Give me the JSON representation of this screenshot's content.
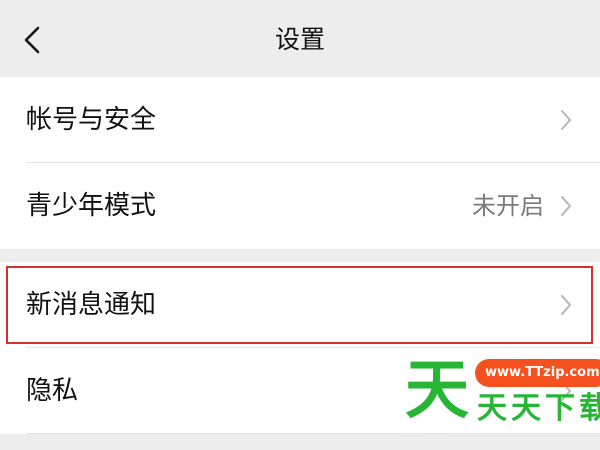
{
  "nav": {
    "title": "设置",
    "back_icon": "chevron-left-icon"
  },
  "groups": [
    {
      "rows": [
        {
          "label": "帐号与安全",
          "value": ""
        },
        {
          "label": "青少年模式",
          "value": "未开启"
        }
      ]
    },
    {
      "rows": [
        {
          "label": "新消息通知",
          "value": "",
          "highlighted": true
        },
        {
          "label": "隐私",
          "value": ""
        }
      ]
    }
  ],
  "watermark": {
    "big_char": "天",
    "url": "www.TTzip.com",
    "text": "天天下载"
  },
  "colors": {
    "background": "#ededed",
    "row_background": "#ffffff",
    "highlight": "#d9302c",
    "watermark_green": "#27b536",
    "watermark_orange": "#f4511e"
  }
}
